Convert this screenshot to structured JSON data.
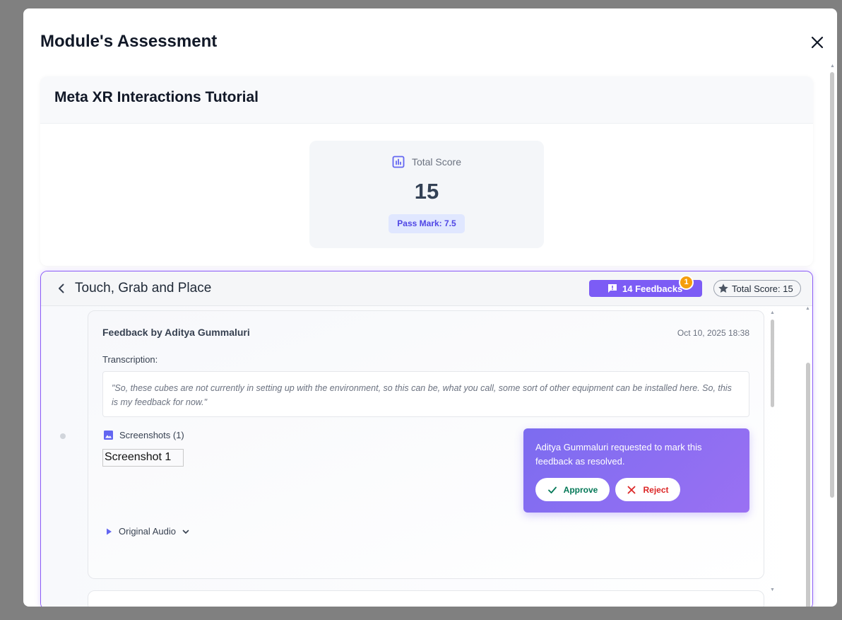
{
  "modal": {
    "title": "Module's Assessment",
    "close_icon": "close-icon"
  },
  "module": {
    "title": "Meta XR Interactions Tutorial",
    "total_score_label": "Total Score",
    "total_score_value": "15",
    "pass_mark": "Pass Mark: 7.5"
  },
  "section": {
    "title": "Touch, Grab and Place",
    "feedbacks_label": "14 Feedbacks",
    "notification_count": "1",
    "total_score": "Total Score: 15"
  },
  "feedback": {
    "author": "Feedback by Aditya Gummaluri",
    "date": "Oct 10, 2025 18:38",
    "transcription_label": "Transcription:",
    "transcription": "\"So, these cubes are not currently in setting up with the environment, so this can be, what you call, some sort of other equipment can be installed here. So, this is my feedback for now.\"",
    "screenshots_label": "Screenshots (1)",
    "screenshot_alt": "Screenshot 1",
    "audio_label": "Original Audio"
  },
  "resolve_request": {
    "message": "Aditya Gummaluri requested to mark this feedback as resolved.",
    "approve_label": "Approve",
    "reject_label": "Reject"
  },
  "colors": {
    "accent": "#7c5cf5",
    "approve": "#047857",
    "reject": "#dc2626",
    "badge": "#f59e0b"
  }
}
